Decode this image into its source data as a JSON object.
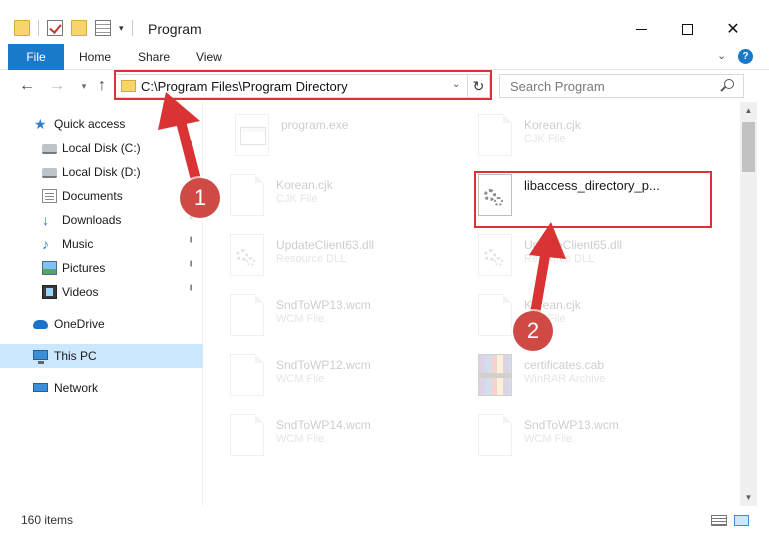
{
  "window": {
    "title": "Program",
    "minimize_glyph": "",
    "close_glyph": "✕"
  },
  "ribbon": {
    "tabs": [
      "File",
      "Home",
      "Share",
      "View"
    ],
    "help_glyph": "?"
  },
  "nav": {
    "back_glyph": "←",
    "forward_glyph": "→",
    "recent_glyph": "▾",
    "up_glyph": "↑",
    "address": "C:\\Program Files\\Program Directory",
    "refresh_glyph": "↻",
    "search_placeholder": "Search Program"
  },
  "sidebar": {
    "items": [
      {
        "label": "Quick access",
        "icon": "quick-access-star-icon",
        "pinned": false
      },
      {
        "label": "Local Disk (C:)",
        "icon": "local-disk-icon",
        "pinned": true
      },
      {
        "label": "Local Disk (D:)",
        "icon": "local-disk-icon",
        "pinned": true
      },
      {
        "label": "Documents",
        "icon": "documents-icon",
        "pinned": true
      },
      {
        "label": "Downloads",
        "icon": "downloads-icon",
        "pinned": true
      },
      {
        "label": "Music",
        "icon": "music-icon",
        "pinned": true
      },
      {
        "label": "Pictures",
        "icon": "pictures-icon",
        "pinned": true
      },
      {
        "label": "Videos",
        "icon": "videos-icon",
        "pinned": true
      },
      {
        "label": "OneDrive",
        "icon": "onedrive-cloud-icon",
        "pinned": false
      },
      {
        "label": "This PC",
        "icon": "this-pc-icon",
        "pinned": false,
        "selected": true
      },
      {
        "label": "Network",
        "icon": "network-icon",
        "pinned": false
      }
    ],
    "pin_glyph": "📌"
  },
  "files": [
    {
      "name": "program.exe",
      "type": "",
      "icon": "exe-icon"
    },
    {
      "name": "Korean.cjk",
      "type": "CJK File",
      "icon": "document-icon"
    },
    {
      "name": "Korean.cjk",
      "type": "CJK File",
      "icon": "document-icon"
    },
    {
      "name": "libaccess_directory_p...",
      "type": "",
      "icon": "dll-gear-icon"
    },
    {
      "name": "UpdateClient63.dll",
      "type": "Resource DLL",
      "icon": "dll-gear-icon"
    },
    {
      "name": "UpdateClient65.dll",
      "type": "Resource DLL",
      "icon": "dll-gear-icon"
    },
    {
      "name": "SndToWP13.wcm",
      "type": "WCM File",
      "icon": "document-icon"
    },
    {
      "name": "Korean.cjk",
      "type": "CJK File",
      "icon": "document-icon"
    },
    {
      "name": "SndToWP12.wcm",
      "type": "WCM File",
      "icon": "document-icon"
    },
    {
      "name": "certificates.cab",
      "type": "WinRAR Archive",
      "icon": "winrar-archive-icon"
    },
    {
      "name": "SndToWP14.wcm",
      "type": "WCM File",
      "icon": "document-icon"
    },
    {
      "name": "SndToWP13.wcm",
      "type": "WCM File",
      "icon": "document-icon"
    }
  ],
  "status": {
    "item_count": "160 items"
  },
  "annotations": {
    "badge_1": "1",
    "badge_2": "2",
    "color": "#d93333"
  },
  "colors": {
    "accent": "#1979ca",
    "selection": "#cce8ff"
  }
}
